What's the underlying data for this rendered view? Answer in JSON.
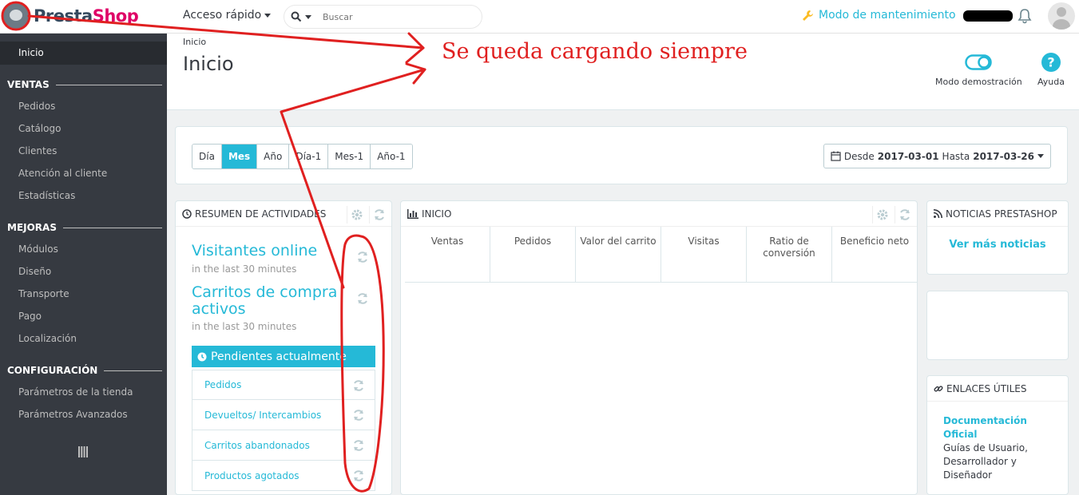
{
  "brand": {
    "name_part1": "Presta",
    "name_part2": "Shop"
  },
  "header": {
    "quick_access": "Acceso rápido",
    "search_placeholder": "Buscar",
    "maintenance": "Modo de mantenimiento"
  },
  "sidebar": {
    "home": "Inicio",
    "sections": [
      {
        "title": "VENTAS",
        "items": [
          "Pedidos",
          "Catálogo",
          "Clientes",
          "Atención al cliente",
          "Estadísticas"
        ]
      },
      {
        "title": "MEJORAS",
        "items": [
          "Módulos",
          "Diseño",
          "Transporte",
          "Pago",
          "Localización"
        ]
      },
      {
        "title": "CONFIGURACIÓN",
        "items": [
          "Parámetros de la tienda",
          "Parámetros Avanzados"
        ]
      }
    ]
  },
  "page": {
    "breadcrumb": "Inicio",
    "title": "Inicio",
    "demo_mode": "Modo demostración",
    "help": "Ayuda"
  },
  "period": {
    "buttons": [
      "Día",
      "Mes",
      "Año",
      "Día-1",
      "Mes-1",
      "Año-1"
    ],
    "active": "Mes",
    "from_label": "Desde",
    "from": "2017-03-01",
    "to_label": "Hasta",
    "to": "2017-03-26"
  },
  "activity": {
    "title": "RESUMEN DE ACTIVIDADES",
    "online_visitors": "Visitantes online",
    "online_sub": "in the last 30 minutes",
    "active_carts_line1": "Carritos de compra",
    "active_carts_line2": "activos",
    "carts_sub": "in the last 30 minutes",
    "pending_title": "Pendientes actualmente",
    "pending_items": [
      "Pedidos",
      "Devueltos/ Intercambios",
      "Carritos abandonados",
      "Productos agotados"
    ]
  },
  "dashboard": {
    "title": "INICIO",
    "kpis": [
      "Ventas",
      "Pedidos",
      "Valor del carrito",
      "Visitas",
      "Ratio de conversión",
      "Beneficio neto"
    ]
  },
  "news": {
    "title": "NOTICIAS PRESTASHOP",
    "more": "Ver más noticias"
  },
  "links": {
    "title": "ENLACES ÚTILES",
    "doc_title": "Documentación Oficial",
    "doc_desc": "Guías de Usuario, Desarrollador y Diseñador"
  },
  "annotation": {
    "text": "Se queda cargando siempre",
    "color": "#e02020"
  },
  "colors": {
    "accent": "#25b9d7",
    "sidebar": "#363a41",
    "brand_pink": "#df0067"
  }
}
